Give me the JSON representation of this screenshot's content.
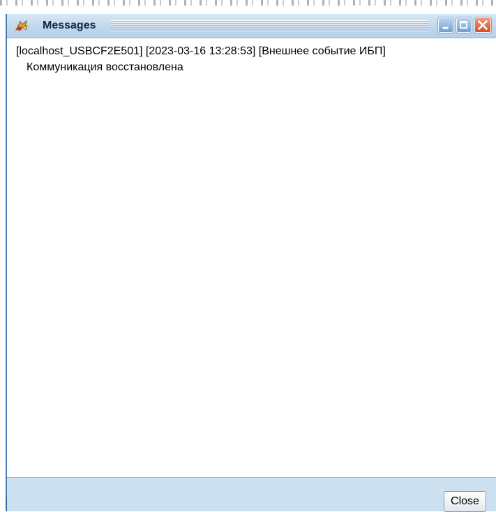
{
  "window": {
    "title": "Messages",
    "title_icon": "messages-app-icon",
    "controls": {
      "minimize_icon": "minimize-icon",
      "maximize_icon": "maximize-icon",
      "close_icon": "close-icon"
    }
  },
  "messages": [
    {
      "header": "[localhost_USBCF2E501] [2023-03-16 13:28:53] [Внешнее событие ИБП]",
      "body": "Коммуникация восстановлена"
    }
  ],
  "footer": {
    "close_label": "Close"
  },
  "colors": {
    "window_background": "#cde0ef",
    "titlebar_text": "#0d2a44",
    "close_control": "#d64b25",
    "content_background": "#ffffff"
  }
}
